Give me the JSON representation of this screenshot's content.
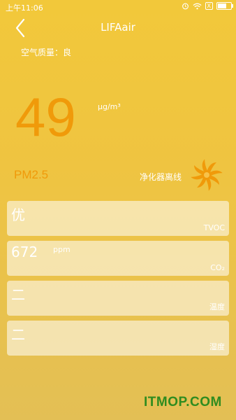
{
  "status_bar": {
    "time": "上午11:06",
    "icons": [
      "alarm-icon",
      "wifi-icon",
      "sim-icon",
      "battery-icon"
    ],
    "sim_label": "X",
    "battery_level": 0.7
  },
  "header": {
    "title": "LIFAair",
    "back_icon": "chevron-left-icon"
  },
  "air_quality_label": "空气质量：良",
  "pm": {
    "value": "49",
    "unit": "μg/m³",
    "label": "PM2.5"
  },
  "purifier": {
    "status": "净化器离线",
    "icon": "fan-icon"
  },
  "cards": [
    {
      "value": "优",
      "unit": "",
      "label": "TVOC"
    },
    {
      "value": "672",
      "unit": "ppm",
      "label": "CO₂"
    },
    {
      "value": "二",
      "unit": "",
      "label": "温度"
    },
    {
      "value": "二",
      "unit": "",
      "label": "湿度"
    }
  ],
  "watermark": "ITMOP.COM",
  "colors": {
    "accent_orange": "#f09a0a",
    "background_top": "#f2c83a",
    "watermark_green": "#2f8c1f"
  }
}
